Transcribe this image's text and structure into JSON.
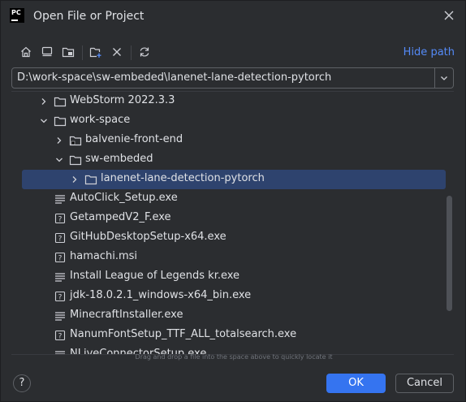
{
  "window": {
    "title": "Open File or Project",
    "app_logo_text": "PC"
  },
  "toolbar": {
    "buttons": [
      "home-icon",
      "desktop-icon",
      "project-folder-icon",
      "new-folder-icon",
      "delete-icon",
      "refresh-icon"
    ],
    "hide_path_label": "Hide path"
  },
  "path": {
    "value": "D:\\work-space\\sw-embeded\\lanenet-lane-detection-pytorch"
  },
  "tree": {
    "items": [
      {
        "label": "WebStorm 2022.3.3",
        "icon": "folder-icon",
        "expander": "collapsed"
      },
      {
        "label": "work-space",
        "icon": "folder-icon",
        "expander": "expanded"
      },
      {
        "label": "balvenie-front-end",
        "icon": "project-folder-icon",
        "expander": "collapsed"
      },
      {
        "label": "sw-embeded",
        "icon": "folder-icon",
        "expander": "expanded"
      },
      {
        "label": "lanenet-lane-detection-pytorch",
        "icon": "folder-icon",
        "expander": "collapsed",
        "selected": true
      },
      {
        "label": "AutoClick_Setup.exe",
        "icon": "text-file-icon"
      },
      {
        "label": "GetampedV2_F.exe",
        "icon": "unknown-file-icon"
      },
      {
        "label": "GitHubDesktopSetup-x64.exe",
        "icon": "unknown-file-icon"
      },
      {
        "label": "hamachi.msi",
        "icon": "unknown-file-icon"
      },
      {
        "label": "Install League of Legends kr.exe",
        "icon": "text-file-icon"
      },
      {
        "label": "jdk-18.0.2.1_windows-x64_bin.exe",
        "icon": "unknown-file-icon"
      },
      {
        "label": "MinecraftInstaller.exe",
        "icon": "text-file-icon"
      },
      {
        "label": "NanumFontSetup_TTF_ALL_totalsearch.exe",
        "icon": "unknown-file-icon"
      },
      {
        "label": "NLiveConnectorSetup.exe",
        "icon": "text-file-icon"
      }
    ]
  },
  "hint": "Drag and drop a file into the space above to quickly locate it",
  "buttons": {
    "help": "?",
    "ok": "OK",
    "cancel": "Cancel"
  },
  "colors": {
    "accent": "#3574f0",
    "link": "#548af7",
    "selection": "#2e436e",
    "background": "#2b2d30"
  }
}
